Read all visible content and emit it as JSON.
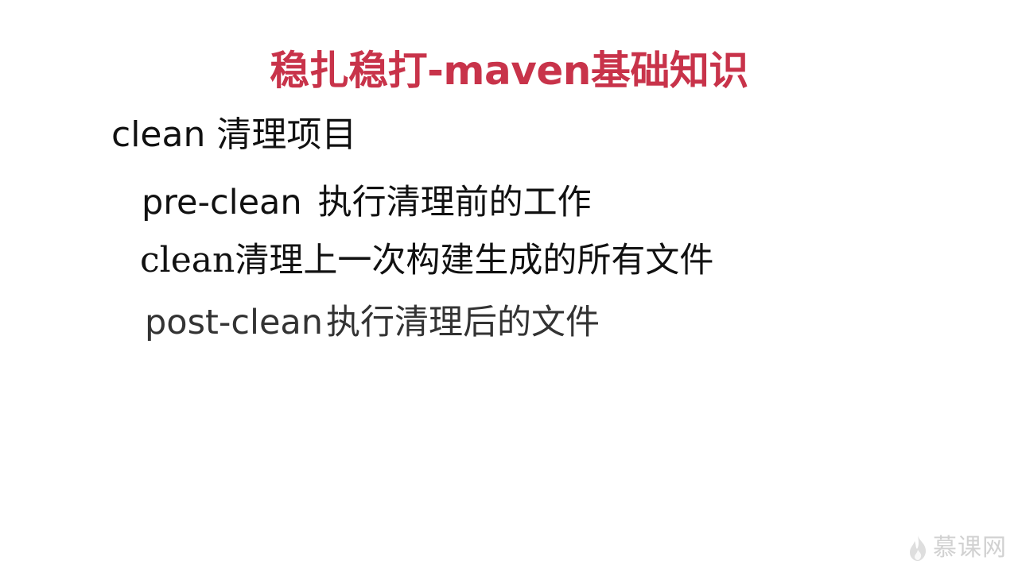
{
  "slide": {
    "title": "稳扎稳打-maven基础知识",
    "heading": "clean 清理项目",
    "items": [
      {
        "term": "pre-clean",
        "description": "执行清理前的工作"
      },
      {
        "term": "clean",
        "description": "清理上一次构建生成的所有文件"
      },
      {
        "term": "post-clean",
        "description": "执行清理后的文件"
      }
    ]
  },
  "watermark": {
    "text": "慕课网",
    "icon": "flame-logo-icon"
  },
  "colors": {
    "title": "#c8334a",
    "body_text": "#111111",
    "watermark": "#c9c9c9"
  }
}
